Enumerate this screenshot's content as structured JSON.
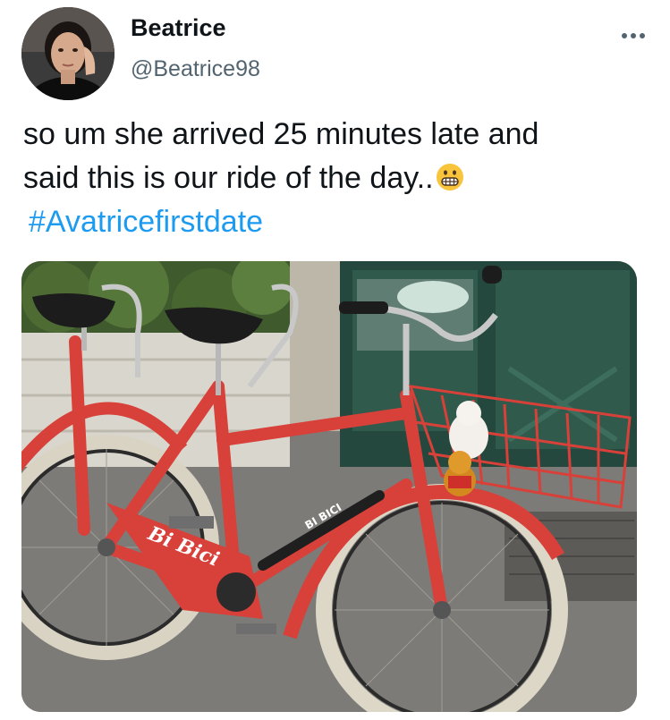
{
  "tweet": {
    "author": {
      "display_name": "Beatrice",
      "handle": "@Beatrice98",
      "avatar_icon": "profile-photo"
    },
    "more_icon": "more-horizontal-icon",
    "text_line1": "so um she arrived 25 minutes late and",
    "text_line2": "said this is our ride of the day..",
    "emoji": "grimacing-face-emoji",
    "hashtag": "#Avatricefirstdate",
    "media": {
      "description_icon": "photo-red-bicycle-with-basket",
      "frame_text": "Bi Bici",
      "tube_text": "BI BICI"
    },
    "colors": {
      "text": "#0f1419",
      "secondary": "#536471",
      "link": "#1d9bf0",
      "bike_red": "#d8403a"
    }
  }
}
